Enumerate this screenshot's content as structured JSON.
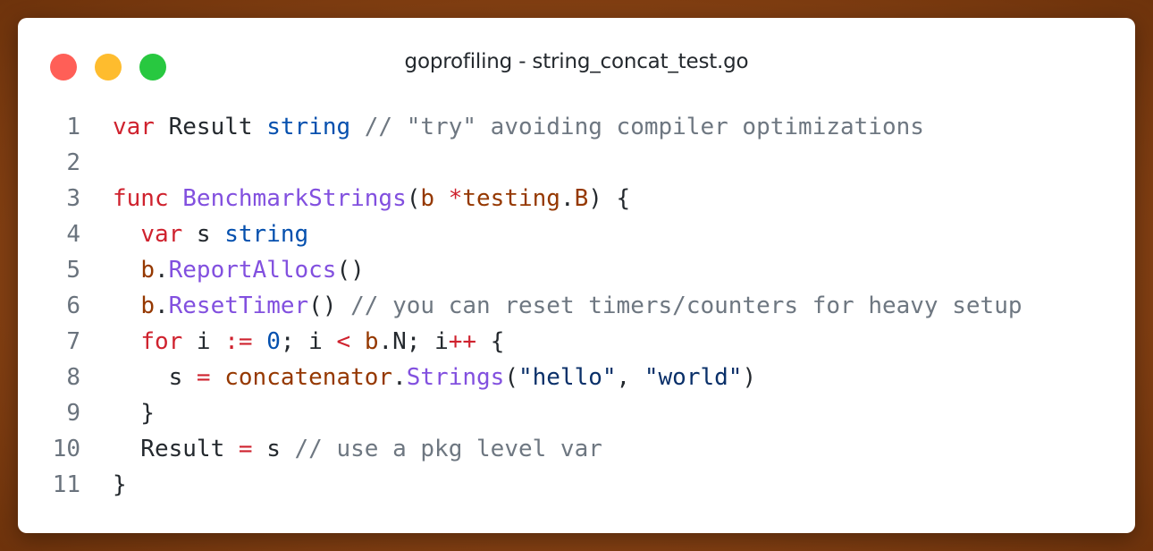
{
  "window": {
    "title": "goprofiling - string_concat_test.go",
    "buttons": [
      {
        "name": "close",
        "color": "#ff5f57"
      },
      {
        "name": "minimize",
        "color": "#febc2e"
      },
      {
        "name": "maximize",
        "color": "#28c840"
      }
    ]
  },
  "colors": {
    "keyword": "#cf222e",
    "type": "#0550ae",
    "function": "#8250df",
    "identifier": "#953800",
    "operator": "#cf222e",
    "number": "#0550ae",
    "string": "#0a3069",
    "comment": "#6e7781",
    "plain": "#24292e"
  },
  "code": {
    "lines": [
      {
        "n": "1",
        "tokens": [
          {
            "t": "kw",
            "v": "var"
          },
          {
            "t": "plain",
            "v": " Result "
          },
          {
            "t": "type",
            "v": "string"
          },
          {
            "t": "plain",
            "v": " "
          },
          {
            "t": "cmt",
            "v": "// \"try\" avoiding compiler optimizations"
          }
        ]
      },
      {
        "n": "2",
        "tokens": []
      },
      {
        "n": "3",
        "tokens": [
          {
            "t": "kw",
            "v": "func"
          },
          {
            "t": "plain",
            "v": " "
          },
          {
            "t": "fn",
            "v": "BenchmarkStrings"
          },
          {
            "t": "plain",
            "v": "("
          },
          {
            "t": "id",
            "v": "b"
          },
          {
            "t": "plain",
            "v": " "
          },
          {
            "t": "op",
            "v": "*"
          },
          {
            "t": "id",
            "v": "testing"
          },
          {
            "t": "plain",
            "v": "."
          },
          {
            "t": "id",
            "v": "B"
          },
          {
            "t": "plain",
            "v": ") {"
          }
        ]
      },
      {
        "n": "4",
        "tokens": [
          {
            "t": "plain",
            "v": "  "
          },
          {
            "t": "kw",
            "v": "var"
          },
          {
            "t": "plain",
            "v": " s "
          },
          {
            "t": "type",
            "v": "string"
          }
        ]
      },
      {
        "n": "5",
        "tokens": [
          {
            "t": "plain",
            "v": "  "
          },
          {
            "t": "id",
            "v": "b"
          },
          {
            "t": "plain",
            "v": "."
          },
          {
            "t": "fn",
            "v": "ReportAllocs"
          },
          {
            "t": "plain",
            "v": "()"
          }
        ]
      },
      {
        "n": "6",
        "tokens": [
          {
            "t": "plain",
            "v": "  "
          },
          {
            "t": "id",
            "v": "b"
          },
          {
            "t": "plain",
            "v": "."
          },
          {
            "t": "fn",
            "v": "ResetTimer"
          },
          {
            "t": "plain",
            "v": "() "
          },
          {
            "t": "cmt",
            "v": "// you can reset timers/counters for heavy setup"
          }
        ]
      },
      {
        "n": "7",
        "tokens": [
          {
            "t": "plain",
            "v": "  "
          },
          {
            "t": "kw",
            "v": "for"
          },
          {
            "t": "plain",
            "v": " i "
          },
          {
            "t": "op",
            "v": ":="
          },
          {
            "t": "plain",
            "v": " "
          },
          {
            "t": "num",
            "v": "0"
          },
          {
            "t": "plain",
            "v": "; i "
          },
          {
            "t": "op",
            "v": "<"
          },
          {
            "t": "plain",
            "v": " "
          },
          {
            "t": "id",
            "v": "b"
          },
          {
            "t": "plain",
            "v": ".N; i"
          },
          {
            "t": "op",
            "v": "++"
          },
          {
            "t": "plain",
            "v": " {"
          }
        ]
      },
      {
        "n": "8",
        "tokens": [
          {
            "t": "plain",
            "v": "    s "
          },
          {
            "t": "op",
            "v": "="
          },
          {
            "t": "plain",
            "v": " "
          },
          {
            "t": "id",
            "v": "concatenator"
          },
          {
            "t": "plain",
            "v": "."
          },
          {
            "t": "fn",
            "v": "Strings"
          },
          {
            "t": "plain",
            "v": "("
          },
          {
            "t": "str",
            "v": "\"hello\""
          },
          {
            "t": "plain",
            "v": ", "
          },
          {
            "t": "str",
            "v": "\"world\""
          },
          {
            "t": "plain",
            "v": ")"
          }
        ]
      },
      {
        "n": "9",
        "tokens": [
          {
            "t": "plain",
            "v": "  }"
          }
        ]
      },
      {
        "n": "10",
        "tokens": [
          {
            "t": "plain",
            "v": "  Result "
          },
          {
            "t": "op",
            "v": "="
          },
          {
            "t": "plain",
            "v": " s "
          },
          {
            "t": "cmt",
            "v": "// use a pkg level var"
          }
        ]
      },
      {
        "n": "11",
        "tokens": [
          {
            "t": "plain",
            "v": "}"
          }
        ]
      }
    ]
  }
}
